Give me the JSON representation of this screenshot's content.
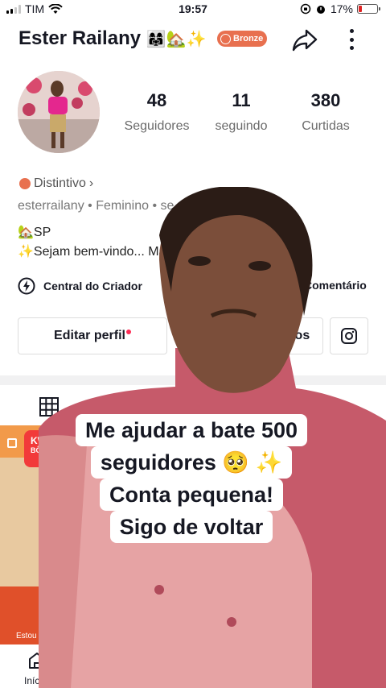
{
  "status_bar": {
    "carrier": "TIM",
    "time": "19:57",
    "battery": "17%"
  },
  "profile": {
    "name": "Ester Railany",
    "name_emojis": "👩‍👩‍👧🏡✨",
    "level_badge": "Bronze",
    "stats": [
      {
        "value": "48",
        "label": "Seguidores"
      },
      {
        "value": "11",
        "label": "seguindo"
      },
      {
        "value": "380",
        "label": "Curtidas"
      }
    ],
    "distintivo": "Distintivo",
    "meta": "esterrailany  •  Feminino  •  se",
    "bio_line1": "🏡SP",
    "bio_line2": "✨Sejam bem-vindo... Ma",
    "creator_center": "Central do Criador",
    "comments": "Comentário",
    "edit_profile": "Editar perfil",
    "friends_partial": "gos"
  },
  "thumbnail": {
    "brand": "KWA",
    "sub": "BÔNI",
    "caption": "Estou"
  },
  "bottom_nav": {
    "home_label": "Início"
  },
  "overlay_caption": {
    "lines": [
      "Me ajudar a bate 500",
      "seguidores 🥺 ✨",
      "Conta pequena!",
      "Sigo de voltar"
    ]
  },
  "colors": {
    "accent": "#fe2c55",
    "bronze": "#e8704f",
    "sweater": "#c65a6a"
  }
}
